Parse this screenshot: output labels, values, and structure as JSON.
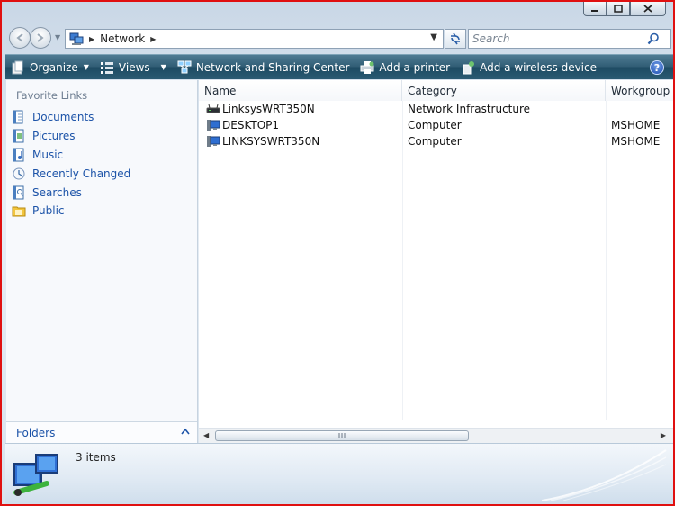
{
  "window": {
    "caption_buttons": [
      "minimize",
      "maximize",
      "close"
    ]
  },
  "address": {
    "location": "Network",
    "search_placeholder": "Search"
  },
  "toolbar": {
    "organize": "Organize",
    "views": "Views",
    "network_sharing": "Network and Sharing Center",
    "add_printer": "Add a printer",
    "add_wireless": "Add a wireless device",
    "help": "?"
  },
  "nav": {
    "heading": "Favorite Links",
    "links": [
      {
        "label": "Documents",
        "icon": "documents-icon"
      },
      {
        "label": "Pictures",
        "icon": "pictures-icon"
      },
      {
        "label": "Music",
        "icon": "music-icon"
      },
      {
        "label": "Recently Changed",
        "icon": "recently-changed-icon"
      },
      {
        "label": "Searches",
        "icon": "searches-icon"
      },
      {
        "label": "Public",
        "icon": "public-folder-icon"
      }
    ],
    "folders": "Folders"
  },
  "list": {
    "columns": [
      "Name",
      "Category",
      "Workgroup"
    ],
    "rows": [
      {
        "name": "LinksysWRT350N",
        "category": "Network Infrastructure",
        "workgroup": "",
        "icon": "router-icon"
      },
      {
        "name": "DESKTOP1",
        "category": "Computer",
        "workgroup": "MSHOME",
        "icon": "computer-icon"
      },
      {
        "name": "LINKSYSWRT350N",
        "category": "Computer",
        "workgroup": "MSHOME",
        "icon": "computer-icon"
      }
    ]
  },
  "details": {
    "item_count": "3 items"
  },
  "colors": {
    "toolbar_top": "#4f7b93",
    "toolbar_bottom": "#1d4a62",
    "link_blue": "#1c53a8",
    "frame_red": "#e01010"
  }
}
